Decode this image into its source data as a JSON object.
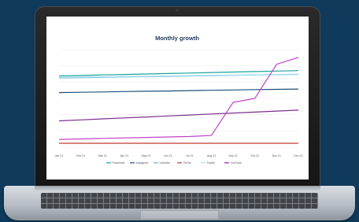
{
  "chart_data": {
    "type": "line",
    "title": "Monthly growth",
    "categories": [
      "Jan 21",
      "Feb 21",
      "Mar 21",
      "Apr 21",
      "May 21",
      "Jun 21",
      "Jul 21",
      "Aug 21",
      "Sep 21",
      "Oct 21",
      "Nov 21",
      "Dec 21"
    ],
    "ylim": [
      0,
      100
    ],
    "grid": true,
    "legend_position": "bottom",
    "series": [
      {
        "name": "Facebook",
        "color": "#1aa39a",
        "values": [
          73,
          73.5,
          74,
          74.5,
          75,
          75.5,
          76,
          76.5,
          77,
          77.5,
          78,
          78.5
        ]
      },
      {
        "name": "Instagram",
        "color": "#1f4e79",
        "values": [
          56,
          56.3,
          56.6,
          57,
          57.3,
          57.6,
          58,
          58.3,
          58.6,
          59,
          59.3,
          59.6
        ]
      },
      {
        "name": "Linkedin",
        "color": "#5fb7d4",
        "values": [
          71,
          71.3,
          71.6,
          72,
          72.3,
          72.6,
          73,
          73.3,
          73.6,
          74,
          74.3,
          74.6
        ]
      },
      {
        "name": "TikTok",
        "color": "#c0392b",
        "values": [
          4,
          4,
          4,
          4,
          4,
          4,
          4,
          4,
          4,
          4,
          4,
          4
        ]
      },
      {
        "name": "Twitter",
        "color": "#a8dff0",
        "values": [
          71.5,
          71.8,
          72.1,
          72.4,
          72.7,
          73,
          73.3,
          73.6,
          73.9,
          74.2,
          74.5,
          74.8
        ]
      },
      {
        "name": "YouTube",
        "color": "#7b2d8e",
        "values": [
          27,
          28,
          29,
          30,
          31,
          32,
          33,
          34,
          35,
          36,
          37,
          38
        ]
      },
      {
        "name": "",
        "color": "#c040c8",
        "values": [
          8,
          8.5,
          9,
          9.5,
          10,
          10.5,
          11,
          12,
          46,
          50,
          85,
          92
        ]
      }
    ]
  }
}
